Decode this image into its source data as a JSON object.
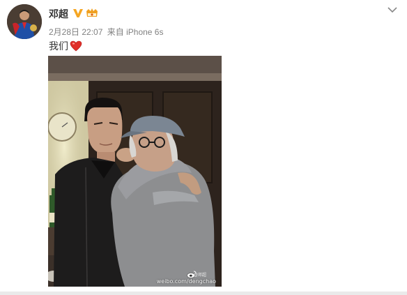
{
  "post": {
    "username": "邓超",
    "time": "2月28日 22:07",
    "source_prefix": "来自",
    "source_device": "iPhone 6s",
    "text": "我们",
    "watermark_text": "weibo.com/dengchao",
    "watermark_handle": "@邓超"
  },
  "icons": {
    "verified": "verified-v-icon",
    "member": "vip-member-icon",
    "chevron": "chevron-down-icon",
    "heart": "heart-emoji-icon",
    "weibo_logo": "weibo-logo-icon"
  },
  "colors": {
    "verified": "#f5a623",
    "member": "#f0a020",
    "heart": "#e0302a",
    "meta_text": "#808080"
  }
}
